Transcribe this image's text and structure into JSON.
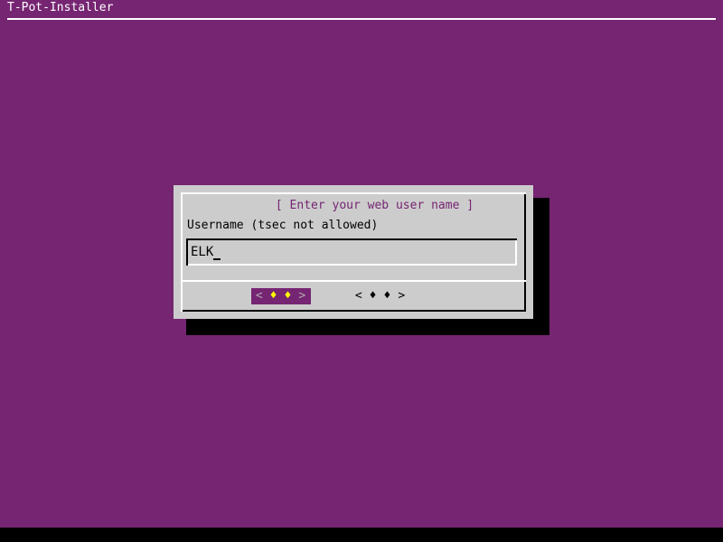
{
  "screen": {
    "background_color": "#762572",
    "bottom_bar_color": "#000000"
  },
  "header": {
    "title": "T-Pot-Installer",
    "text_color": "#ffffff"
  },
  "dialog": {
    "title": "[ Enter your web user name ]",
    "title_color": "#762572",
    "background_color": "#cccccc",
    "field": {
      "label": "Username (tsec not allowed)",
      "value": "ELK",
      "placeholder": "",
      "cursor": "_"
    },
    "buttons": [
      {
        "name": "ok",
        "left_bracket": "<",
        "right_bracket": ">",
        "glyph": "♦",
        "glyph_count": 2,
        "selected": true,
        "highlight_color": "#762572",
        "glyph_color": "#ffff00"
      },
      {
        "name": "cancel",
        "left_bracket": "<",
        "right_bracket": ">",
        "glyph": "♦",
        "glyph_count": 2,
        "selected": false,
        "highlight_color": "#cccccc",
        "glyph_color": "#000000"
      }
    ]
  }
}
